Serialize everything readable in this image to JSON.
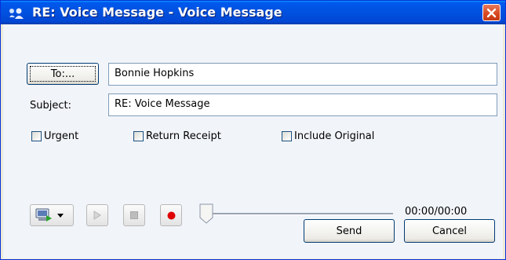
{
  "window": {
    "title": "RE:  Voice Message - Voice Message"
  },
  "form": {
    "to_button": "To:...",
    "to_value": "Bonnie Hopkins",
    "subject_label": "Subject:",
    "subject_value": "RE:  Voice Message"
  },
  "options": [
    {
      "label": "Urgent",
      "checked": false
    },
    {
      "label": "Return Receipt",
      "checked": false
    },
    {
      "label": "Include Original",
      "checked": false
    }
  ],
  "player": {
    "time": "00:00/00:00",
    "icons": [
      "device-icon",
      "dropdown-arrow-icon",
      "play-icon",
      "stop-icon",
      "record-icon"
    ],
    "record_color": "#e00000"
  },
  "actions": {
    "send": "Send",
    "cancel": "Cancel"
  },
  "colors": {
    "titlebar": "#0053e1",
    "client": "#f1f4f9",
    "close": "#d6471f"
  }
}
